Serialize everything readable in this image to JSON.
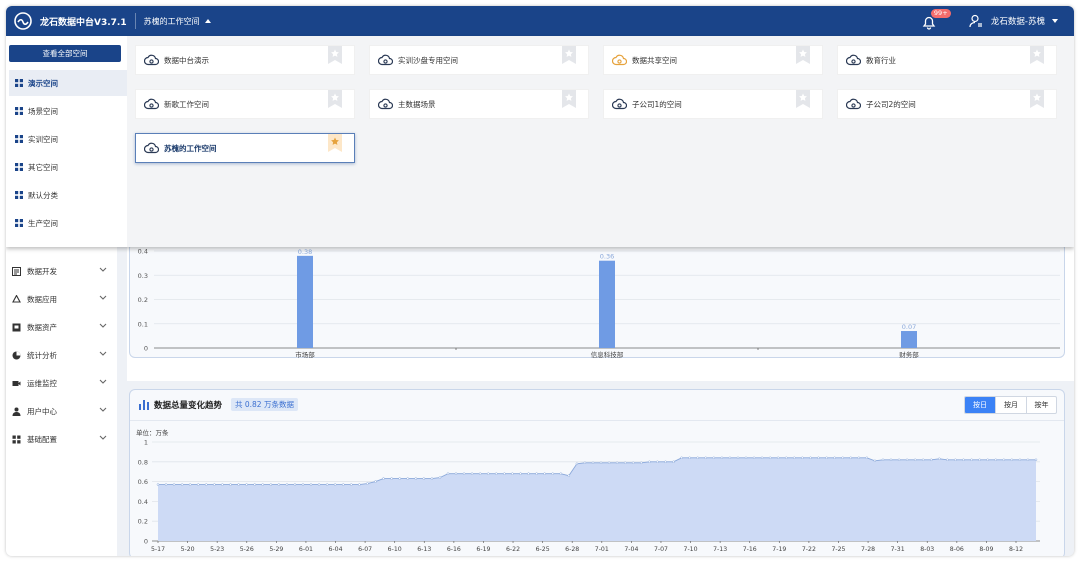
{
  "header": {
    "app_title": "龙石数据中台V3.7.1",
    "workspace_current": "苏槐的工作空间",
    "notifications_badge": "99+",
    "user_name": "龙石数据-苏槐"
  },
  "sidebar": {
    "items": [
      {
        "label": "数据开发",
        "icon": "code-icon"
      },
      {
        "label": "数据应用",
        "icon": "recycle-icon"
      },
      {
        "label": "数据资产",
        "icon": "asset-icon"
      },
      {
        "label": "统计分析",
        "icon": "pie-icon"
      },
      {
        "label": "运维监控",
        "icon": "camera-icon"
      },
      {
        "label": "用户中心",
        "icon": "user-icon"
      },
      {
        "label": "基础配置",
        "icon": "grid-icon"
      }
    ]
  },
  "workspace_dropdown": {
    "view_all_label": "查看全部空间",
    "categories": [
      {
        "label": "演示空间",
        "active": true
      },
      {
        "label": "场景空间",
        "active": false
      },
      {
        "label": "实训空间",
        "active": false
      },
      {
        "label": "其它空间",
        "active": false
      },
      {
        "label": "默认分类",
        "active": false
      },
      {
        "label": "生产空间",
        "active": false
      }
    ],
    "workspaces": [
      {
        "label": "数据中台演示",
        "starred": false,
        "selected": false,
        "icon_color": "#2b3a55"
      },
      {
        "label": "实训沙盘专用空间",
        "starred": false,
        "selected": false,
        "icon_color": "#2b3a55"
      },
      {
        "label": "数据共享空间",
        "starred": false,
        "selected": false,
        "icon_color": "#e6a23c"
      },
      {
        "label": "教育行业",
        "starred": false,
        "selected": false,
        "icon_color": "#2b3a55"
      },
      {
        "label": "新歌工作空间",
        "starred": false,
        "selected": false,
        "icon_color": "#2b3a55"
      },
      {
        "label": "主数据场景",
        "starred": false,
        "selected": false,
        "icon_color": "#2b3a55"
      },
      {
        "label": "子公司1的空间",
        "starred": false,
        "selected": false,
        "icon_color": "#2b3a55"
      },
      {
        "label": "子公司2的空间",
        "starred": false,
        "selected": false,
        "icon_color": "#2b3a55"
      },
      {
        "label": "苏槐的工作空间",
        "starred": true,
        "selected": true,
        "icon_color": "#2b3a55"
      }
    ]
  },
  "dept_chart": {
    "chart_data": {
      "type": "bar",
      "categories": [
        "市场部",
        "信息科技部",
        "财务部"
      ],
      "values": [
        0.38,
        0.36,
        0.07
      ],
      "ylim": [
        0,
        0.4
      ],
      "yticks": [
        "0",
        "0.1",
        "0.2",
        "0.3",
        "0.4"
      ]
    }
  },
  "trend_chart": {
    "title": "数据总量变化趋势",
    "tag": "共 0.82 万条数据",
    "unit_label": "单位：万条",
    "toggle": {
      "day": "按日",
      "month": "按月",
      "year": "按年",
      "active": "day"
    },
    "chart_data": {
      "type": "area",
      "ylim": [
        0,
        1
      ],
      "yticks": [
        "0",
        "0.2",
        "0.4",
        "0.6",
        "0.8",
        "1"
      ],
      "x_labels": [
        "5-17",
        "5-20",
        "5-23",
        "5-26",
        "5-29",
        "6-01",
        "6-04",
        "6-07",
        "6-10",
        "6-13",
        "6-16",
        "6-19",
        "6-22",
        "6-25",
        "6-28",
        "7-01",
        "7-04",
        "7-07",
        "7-10",
        "7-13",
        "7-16",
        "7-19",
        "7-22",
        "7-25",
        "7-28",
        "7-31",
        "8-03",
        "8-06",
        "8-09",
        "8-12"
      ],
      "values": [
        0.57,
        0.57,
        0.57,
        0.57,
        0.57,
        0.57,
        0.57,
        0.57,
        0.57,
        0.57,
        0.57,
        0.57,
        0.57,
        0.57,
        0.57,
        0.57,
        0.57,
        0.57,
        0.57,
        0.57,
        0.57,
        0.57,
        0.57,
        0.57,
        0.57,
        0.57,
        0.58,
        0.6,
        0.63,
        0.63,
        0.63,
        0.63,
        0.63,
        0.63,
        0.63,
        0.64,
        0.68,
        0.68,
        0.68,
        0.68,
        0.68,
        0.68,
        0.68,
        0.68,
        0.68,
        0.68,
        0.68,
        0.68,
        0.68,
        0.68,
        0.68,
        0.66,
        0.78,
        0.79,
        0.79,
        0.79,
        0.79,
        0.79,
        0.79,
        0.79,
        0.79,
        0.8,
        0.8,
        0.8,
        0.8,
        0.84,
        0.84,
        0.84,
        0.84,
        0.84,
        0.84,
        0.84,
        0.84,
        0.84,
        0.84,
        0.84,
        0.84,
        0.84,
        0.84,
        0.84,
        0.84,
        0.84,
        0.84,
        0.84,
        0.84,
        0.84,
        0.84,
        0.84,
        0.84,
        0.81,
        0.82,
        0.82,
        0.82,
        0.82,
        0.82,
        0.82,
        0.82,
        0.83,
        0.82,
        0.82,
        0.82,
        0.82,
        0.82,
        0.82,
        0.82,
        0.82,
        0.82,
        0.82,
        0.82,
        0.82
      ]
    }
  }
}
